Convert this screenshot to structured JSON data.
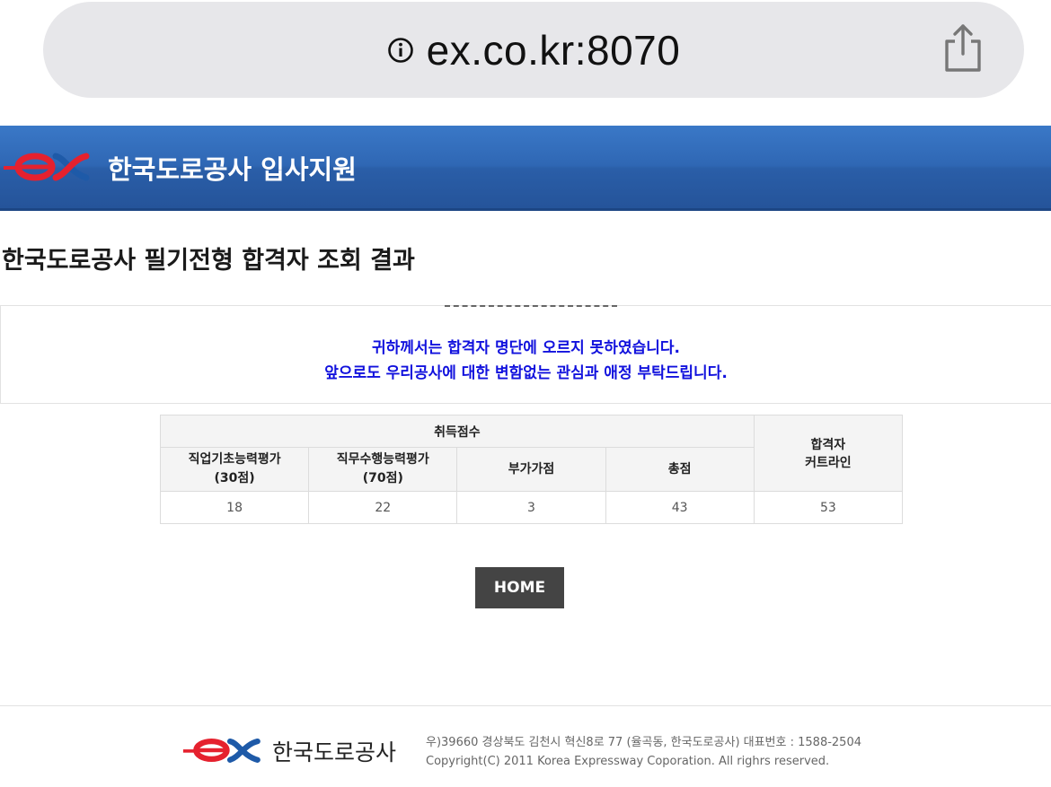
{
  "browser": {
    "url": "ex.co.kr:8070"
  },
  "header": {
    "title": "한국도로공사 입사지원"
  },
  "page": {
    "title": "한국도로공사 필기전형 합격자 조회 결과"
  },
  "notice": {
    "line1": "귀하께서는 합격자 명단에 오르지 못하였습니다.",
    "line2": "앞으로도 우리공사에 대한 변함없는 관심과 애정 부탁드립니다."
  },
  "score_table": {
    "group_header": "취득점수",
    "cutline_header_line1": "합격자",
    "cutline_header_line2": "커트라인",
    "columns": [
      {
        "line1": "직업기초능력평가",
        "line2": "(30점)"
      },
      {
        "line1": "직무수행능력평가",
        "line2": "(70점)"
      },
      {
        "line1": "부가가점",
        "line2": ""
      },
      {
        "line1": "총점",
        "line2": ""
      }
    ],
    "row": [
      "18",
      "22",
      "3",
      "43",
      "53"
    ]
  },
  "buttons": {
    "home": "HOME"
  },
  "footer": {
    "brand": "한국도로공사",
    "address": "우)39660 경상북도 김천시 혁신8로 77 (율곡동, 한국도로공사)   대표번호 : 1588-2504",
    "copyright": "Copyright(C) 2011 Korea Expressway Coporation. All righrs reserved."
  },
  "colors": {
    "header_blue": "#2f67b4",
    "notice_text": "#1111dd",
    "logo_red": "#e5212e",
    "logo_blue": "#1e5aa8",
    "button_bg": "#444444"
  },
  "icons": {
    "info": "info-circle-icon",
    "share": "share-icon",
    "logo": "ex-logo-icon"
  }
}
